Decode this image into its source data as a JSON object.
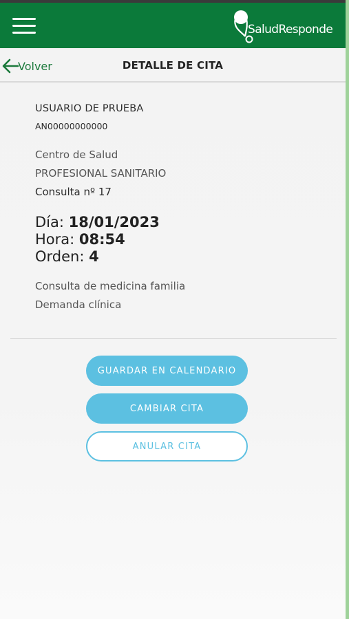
{
  "header": {
    "brand": "SaludResponde",
    "menu_icon": "hamburger-menu-icon",
    "colors": {
      "bar": "#0b7a3a",
      "accent": "#5cc0e1"
    }
  },
  "subheader": {
    "back_label": "Volver",
    "back_icon": "arrow-left-icon",
    "title": "DETALLE DE CITA"
  },
  "appointment": {
    "patient_name": "USUARIO DE PRUEBA",
    "patient_id": "AN00000000000",
    "center": "Centro de Salud",
    "professional": "PROFESIONAL SANITARIO",
    "room": "Consulta nº 17",
    "day_label": "Día:",
    "day_value": "18/01/2023",
    "hour_label": "Hora:",
    "hour_value": "08:54",
    "order_label": "Orden:",
    "order_value": "4",
    "consult_type": "Consulta de medicina familia",
    "demand": "Demanda clínica"
  },
  "actions": {
    "save_calendar": "GUARDAR EN CALENDARIO",
    "change": "CAMBIAR CITA",
    "cancel": "ANULAR CITA"
  }
}
